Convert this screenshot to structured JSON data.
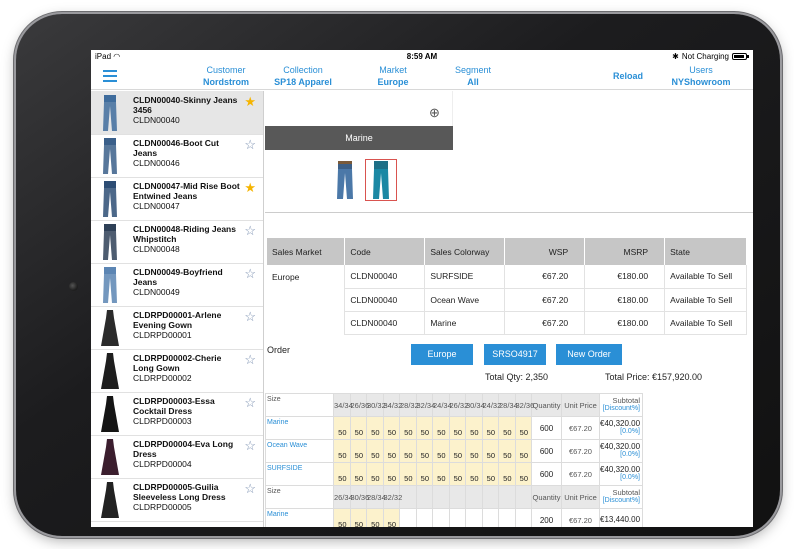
{
  "status_bar": {
    "device": "iPad",
    "time": "8:59 AM",
    "battery_text": "Not Charging"
  },
  "nav": {
    "customer": {
      "label": "Customer",
      "value": "Nordstrom"
    },
    "collection": {
      "label": "Collection",
      "value": "SP18 Apparel"
    },
    "market": {
      "label": "Market",
      "value": "Europe"
    },
    "segment": {
      "label": "Segment",
      "value": "All"
    },
    "reload": "Reload",
    "users": {
      "label": "Users",
      "value": "NYShowroom"
    }
  },
  "sidebar": {
    "items": [
      {
        "name": "CLDN00040-Skinny Jeans 3456",
        "code": "CLDN00040",
        "starred": true,
        "selected": true
      },
      {
        "name": "CLDN00046-Boot Cut Jeans",
        "code": "CLDN00046",
        "starred": false
      },
      {
        "name": "CLDN00047-Mid Rise Boot Entwined Jeans",
        "code": "CLDN00047",
        "starred": true
      },
      {
        "name": "CLDN00048-Riding Jeans Whipstitch",
        "code": "CLDN00048",
        "starred": false
      },
      {
        "name": "CLDN00049-Boyfriend Jeans",
        "code": "CLDN00049",
        "starred": false
      },
      {
        "name": "CLDRPD00001-Arlene Evening Gown",
        "code": "CLDRPD00001",
        "starred": false
      },
      {
        "name": "CLDRPD00002-Cherie Long Gown",
        "code": "CLDRPD00002",
        "starred": false
      },
      {
        "name": "CLDRPD00003-Essa Cocktail Dress",
        "code": "CLDRPD00003",
        "starred": false
      },
      {
        "name": "CLDRPD00004-Eva Long Dress",
        "code": "CLDRPD00004",
        "starred": false
      },
      {
        "name": "CLDRPD00005-Guilia Sleeveless Long Dress",
        "code": "CLDRPD00005",
        "starred": false
      }
    ]
  },
  "preview": {
    "color_label": "Marine"
  },
  "market_table": {
    "headers": [
      "Sales Market",
      "Code",
      "Sales Colorway",
      "WSP",
      "MSRP",
      "State"
    ],
    "rows": [
      [
        "Europe",
        "CLDN00040",
        "SURFSIDE",
        "€67.20",
        "€180.00",
        "Available To Sell"
      ],
      [
        "",
        "CLDN00040",
        "Ocean Wave",
        "€67.20",
        "€180.00",
        "Available To Sell"
      ],
      [
        "",
        "CLDN00040",
        "Marine",
        "€67.20",
        "€180.00",
        "Available To Sell"
      ]
    ]
  },
  "order": {
    "label": "Order",
    "buttons": [
      "Europe",
      "SRSO4917",
      "New Order"
    ],
    "total_qty": "Total Qty: 2,350",
    "total_price": "Total Price: €157,920.00"
  },
  "grid": {
    "size_header": "Size",
    "sizes_a": [
      "34/34",
      "26/36",
      "30/32",
      "34/32",
      "28/32",
      "32/34",
      "24/34",
      "26/32",
      "30/34",
      "24/32",
      "28/34",
      "32/36"
    ],
    "quantity_header": "Quantity",
    "unit_price_header": "Unit Price",
    "subtotal_header": "Subtotal",
    "discount_header": "[Discount%]",
    "rows_a": [
      {
        "colorway": "Marine",
        "qty": "50",
        "total": "600",
        "unit": "€67.20",
        "subtotal": "€40,320.00",
        "discount": "[0.0%]"
      },
      {
        "colorway": "Ocean Wave",
        "qty": "50",
        "total": "600",
        "unit": "€67.20",
        "subtotal": "€40,320.00",
        "discount": "[0.0%]"
      },
      {
        "colorway": "SURFSIDE",
        "qty": "50",
        "total": "600",
        "unit": "€67.20",
        "subtotal": "€40,320.00",
        "discount": "[0.0%]"
      }
    ],
    "sizes_b": [
      "26/34",
      "30/36",
      "28/34",
      "32/32"
    ],
    "rows_b": [
      {
        "colorway": "Marine",
        "qty": "50",
        "total": "200",
        "unit": "€67.20",
        "subtotal": "€13,440.00"
      }
    ]
  },
  "colors": {
    "accent": "#2a8fd6",
    "qty_cell": "#fcf2cc",
    "star": "#f5b400",
    "header_gray": "#c6c6c6",
    "preview_bar": "#585858"
  }
}
